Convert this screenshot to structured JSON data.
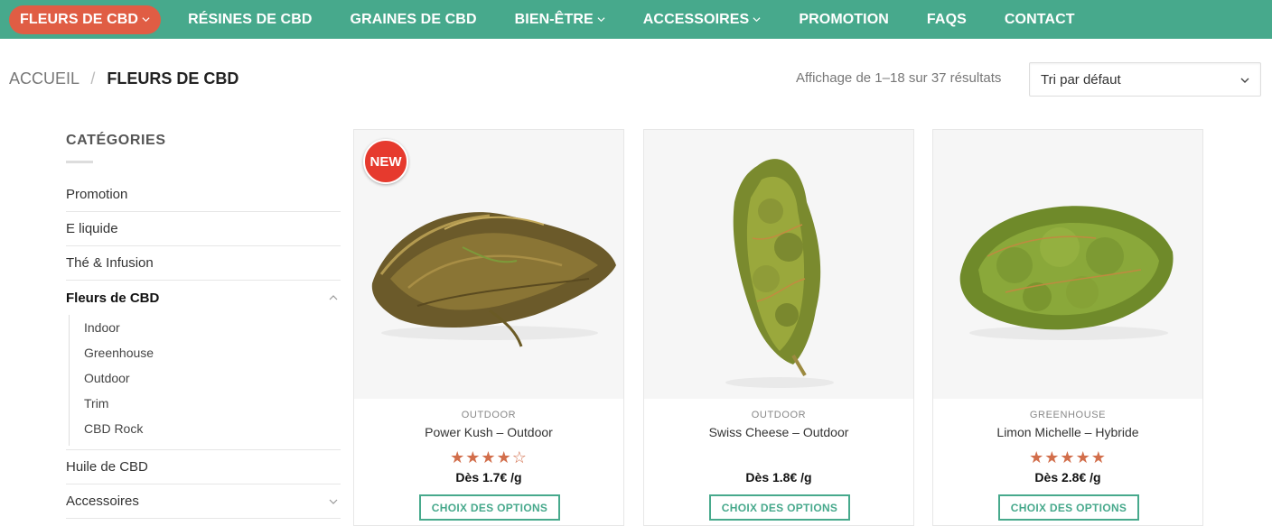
{
  "nav": {
    "items": [
      {
        "label": "FLEURS DE CBD",
        "has_dropdown": true,
        "active": true
      },
      {
        "label": "RÉSINES DE CBD",
        "has_dropdown": false
      },
      {
        "label": "GRAINES DE CBD",
        "has_dropdown": false
      },
      {
        "label": "BIEN-ÊTRE",
        "has_dropdown": true
      },
      {
        "label": "ACCESSOIRES",
        "has_dropdown": true
      },
      {
        "label": "PROMOTION",
        "has_dropdown": false
      },
      {
        "label": "FAQS",
        "has_dropdown": false
      },
      {
        "label": "CONTACT",
        "has_dropdown": false
      }
    ],
    "colors": {
      "bar": "#47a98c",
      "active": "#e05d44"
    }
  },
  "breadcrumb": {
    "home": "ACCUEIL",
    "separator": "/",
    "current": "FLEURS DE CBD"
  },
  "results_text": "Affichage de 1–18 sur 37 résultats",
  "sort": {
    "selected": "Tri par défaut",
    "icon": "chevron-down-icon"
  },
  "sidebar": {
    "title": "CATÉGORIES",
    "items": [
      {
        "label": "Promotion"
      },
      {
        "label": "E liquide"
      },
      {
        "label": "Thé & Infusion"
      },
      {
        "label": "Fleurs de CBD",
        "current": true,
        "icon": "chevron-up-icon"
      },
      {
        "label": "Huile de CBD"
      },
      {
        "label": "Accessoires",
        "icon": "chevron-down-icon"
      }
    ],
    "subitems": [
      {
        "label": "Indoor"
      },
      {
        "label": "Greenhouse"
      },
      {
        "label": "Outdoor"
      },
      {
        "label": "Trim"
      },
      {
        "label": "CBD Rock"
      }
    ]
  },
  "products": [
    {
      "badge": "NEW",
      "category": "OUTDOOR",
      "name": "Power Kush – Outdoor",
      "rating": 4,
      "rating_max": 5,
      "price": "Dès 1.7€ /g",
      "button": "CHOIX DES OPTIONS"
    },
    {
      "badge": "",
      "category": "OUTDOOR",
      "name": "Swiss Cheese – Outdoor",
      "rating": 0,
      "rating_max": 5,
      "price": "Dès 1.8€ /g",
      "button": "CHOIX DES OPTIONS"
    },
    {
      "badge": "",
      "category": "GREENHOUSE",
      "name": "Limon Michelle – Hybride",
      "rating": 5,
      "rating_max": 5,
      "price": "Dès 2.8€ /g",
      "button": "CHOIX DES OPTIONS"
    }
  ],
  "accent_colors": {
    "button": "#47a98c",
    "stars": "#d26e4b",
    "badge": "#e63a2e"
  }
}
